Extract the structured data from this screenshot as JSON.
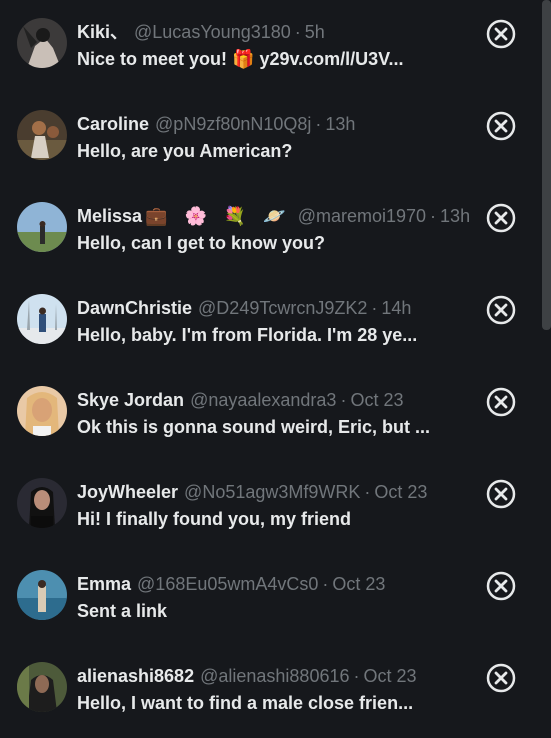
{
  "items": [
    {
      "name": "Kiki、",
      "emojis": "",
      "handle": "@LucasYoung3180",
      "time": "5h",
      "message": "Nice to meet you! 🎁 y29v.com/l/U3V...",
      "avatar_colors": [
        "#3c3a3a",
        "#c9bfb7"
      ]
    },
    {
      "name": "Caroline",
      "emojis": "",
      "handle": "@pN9zf80nN10Q8j",
      "time": "13h",
      "message": "Hello, are you American?",
      "avatar_colors": [
        "#4a3d2f",
        "#a26f48"
      ]
    },
    {
      "name": "Melissa",
      "emojis": "💼 🌸 💐 🪐",
      "handle": "@maremoi1970",
      "time": "13h",
      "message": "Hello, can I get to know you?",
      "avatar_colors": [
        "#8fb4d6",
        "#6d8b4f"
      ]
    },
    {
      "name": "DawnChristie",
      "emojis": "",
      "handle": "@D249TcwrcnJ9ZK2",
      "time": "14h",
      "message": "Hello, baby. I'm from Florida. I'm 28 ye...",
      "avatar_colors": [
        "#cfe1ef",
        "#2f4f7a"
      ]
    },
    {
      "name": "Skye Jordan",
      "emojis": "",
      "handle": "@nayaalexandra3",
      "time": "Oct 23",
      "message": "Ok this is gonna sound weird, Eric, but ...",
      "avatar_colors": [
        "#e9c9a6",
        "#d8a276"
      ]
    },
    {
      "name": "JoyWheeler",
      "emojis": "",
      "handle": "@No51agw3Mf9WRK",
      "time": "Oct 23",
      "message": "Hi! I finally found you, my friend",
      "avatar_colors": [
        "#2a2a33",
        "#b98d79"
      ]
    },
    {
      "name": "Emma",
      "emojis": "",
      "handle": "@168Eu05wmA4vCs0",
      "time": "Oct 23",
      "message": "Sent a link",
      "avatar_colors": [
        "#4d8fb0",
        "#d9cbb5"
      ]
    },
    {
      "name": "alienashi8682",
      "emojis": "",
      "handle": "@alienashi880616",
      "time": "Oct 23",
      "message": "Hello, I want to find a male close frien...",
      "avatar_colors": [
        "#4d5a3a",
        "#1d1d1d"
      ]
    }
  ]
}
